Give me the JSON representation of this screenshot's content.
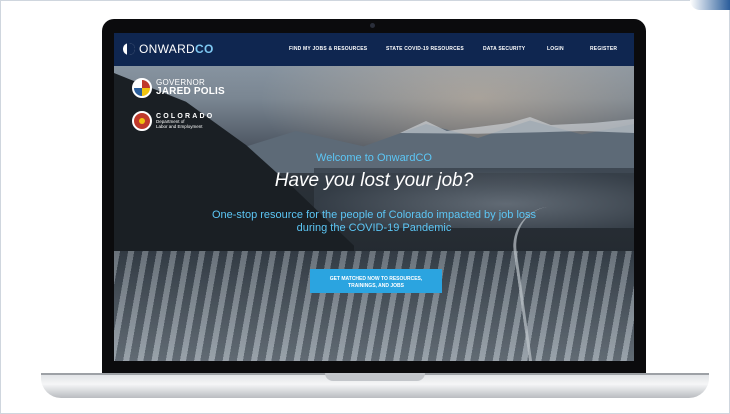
{
  "navbar": {
    "logo": {
      "prefix": "ONWARD",
      "suffix": "CO"
    },
    "links": [
      "FIND MY JOBS & RESOURCES",
      "STATE COVID-19 RESOURCES",
      "DATA SECURITY",
      "LOGIN",
      "REGISTER"
    ]
  },
  "branding": {
    "governor_small": "GOVERNOR",
    "governor_name": "JARED POLIS",
    "dept_state": "COLORADO",
    "dept_line1": "Department of",
    "dept_line2": "Labor and Employment"
  },
  "hero": {
    "welcome": "Welcome to OnwardCO",
    "headline": "Have you lost your job?",
    "tagline": "One-stop resource for the people of Colorado impacted by job loss during the COVID-19 Pandemic",
    "cta_line1": "GET MATCHED NOW TO RESOURCES,",
    "cta_line2": "TRAININGS, AND JOBS"
  },
  "colors": {
    "navbar": "#0f2650",
    "accent": "#5cc6f5",
    "cta": "#2ba4e0"
  }
}
